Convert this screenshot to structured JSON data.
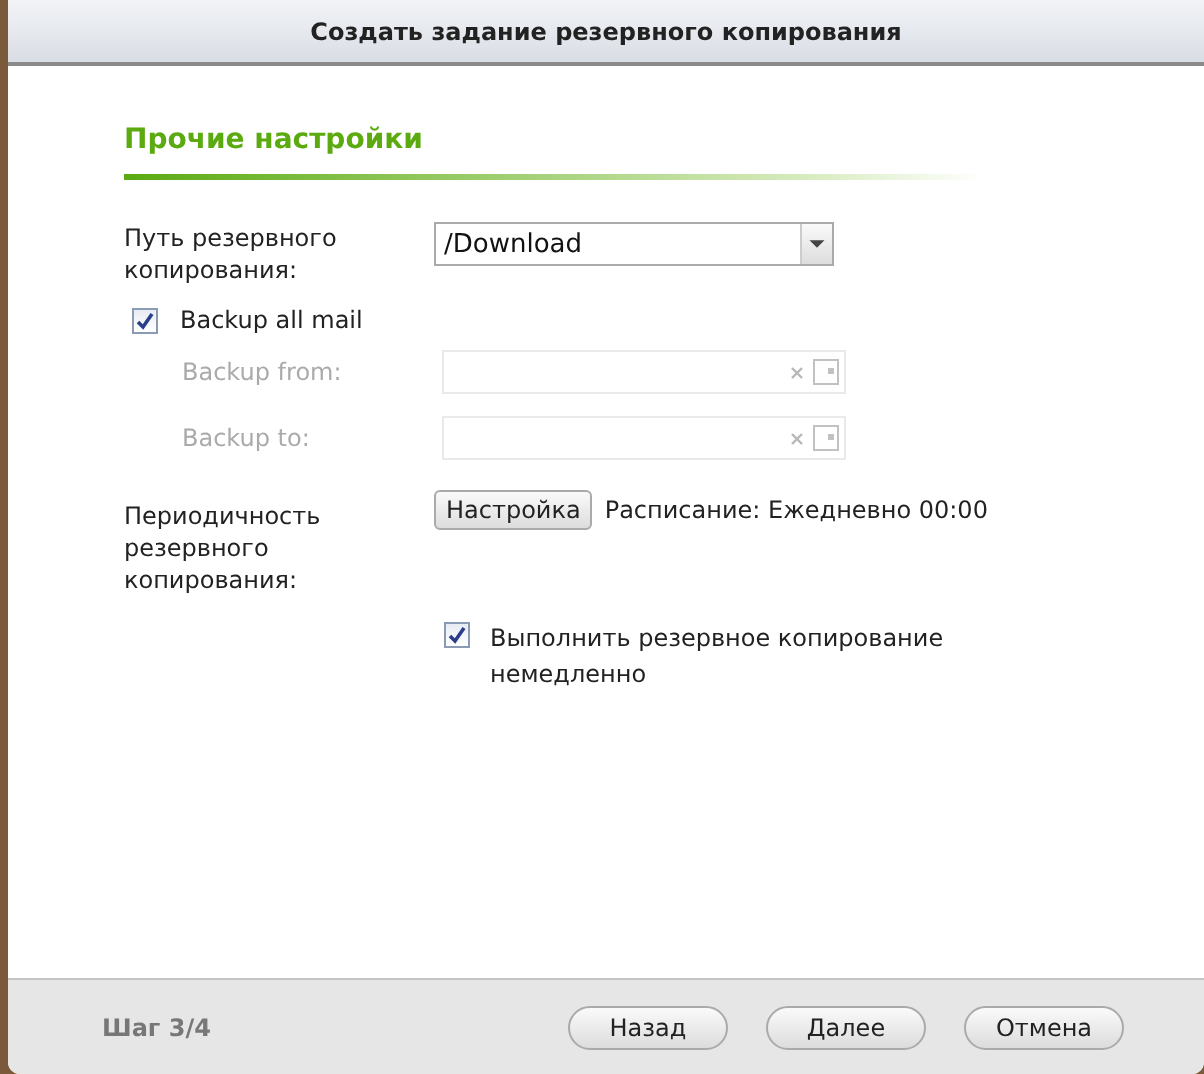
{
  "window": {
    "title": "Создать задание резервного копирования"
  },
  "section_title": "Прочие настройки",
  "backup_path": {
    "label": "Путь резервного копирования:",
    "value": "/Download"
  },
  "backup_all_mail": {
    "label": "Backup all mail",
    "checked": true
  },
  "date_fields": [
    {
      "label": "Backup from:",
      "disabled": true
    },
    {
      "label": "Backup to:",
      "disabled": true
    }
  ],
  "schedule": {
    "label": "Периодичность резервного копирования:",
    "button": "Настройка",
    "text": "Расписание: Ежедневно 00:00"
  },
  "run_now": {
    "label": "Выполнить резервное копирование немедленно",
    "checked": true
  },
  "footer": {
    "step": "Шаг 3/4",
    "buttons": [
      "Назад",
      "Далее",
      "Отмена"
    ]
  }
}
